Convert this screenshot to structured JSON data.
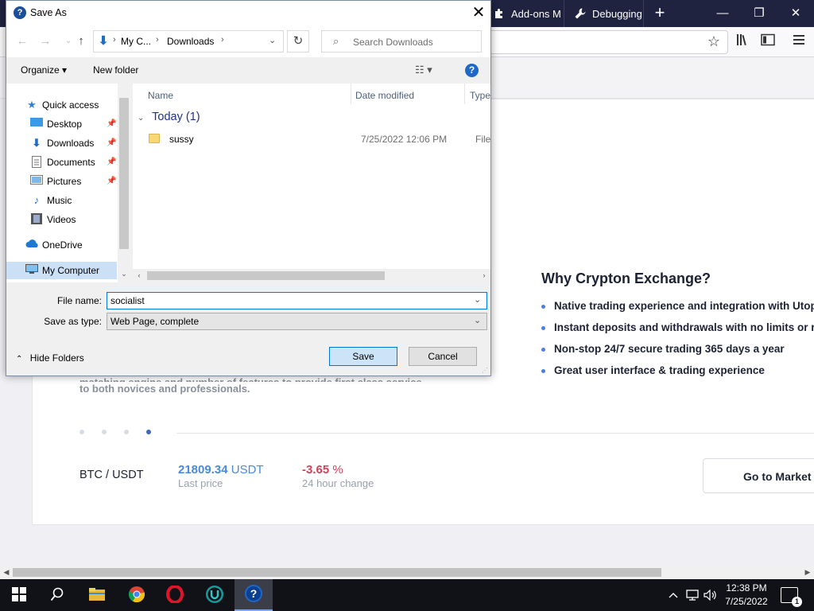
{
  "browser": {
    "tabs": [
      {
        "label": "Add-ons M",
        "icon": "puzzle-icon"
      },
      {
        "label": "Debugging",
        "icon": "wrench-icon"
      }
    ],
    "new_tab": "+",
    "controls": {
      "minimize": "—",
      "maximize": "❐",
      "close": "✕"
    }
  },
  "page": {
    "why_title": "Why Crypton Exchange?",
    "features": [
      "Native trading experience and integration with Utopia",
      "Instant deposits and withdrawals with no limits or restrictions",
      "Non-stop 24/7 secure trading 365 days a year",
      "Great user interface & trading experience"
    ],
    "partial_text_line1": "matching engine and number of features to provide first class service",
    "partial_text_line2": "to both novices and professionals.",
    "pair": "BTC / USDT",
    "last_price_value": "21809.34",
    "last_price_unit": "USDT",
    "last_price_label": "Last price",
    "change_value": "-3.65",
    "change_unit": "%",
    "change_label": "24 hour change",
    "market_button": "Go to Market View",
    "slider_dots": 4,
    "active_dot": 4
  },
  "dialog": {
    "title": "Save As",
    "close": "✕",
    "breadcrumb": [
      "My C...",
      "Downloads"
    ],
    "search_placeholder": "Search Downloads",
    "organize": "Organize ▾",
    "new_folder": "New folder",
    "help": "?",
    "nav_items": [
      {
        "label": "Quick access",
        "icon": "star-icon"
      },
      {
        "label": "Desktop",
        "icon": "desktop-icon",
        "pinned": true
      },
      {
        "label": "Downloads",
        "icon": "download-icon",
        "pinned": true
      },
      {
        "label": "Documents",
        "icon": "document-icon",
        "pinned": true
      },
      {
        "label": "Pictures",
        "icon": "picture-icon",
        "pinned": true
      },
      {
        "label": "Music",
        "icon": "music-icon"
      },
      {
        "label": "Videos",
        "icon": "video-icon"
      },
      {
        "label": "OneDrive",
        "icon": "cloud-icon"
      },
      {
        "label": "My Computer",
        "icon": "computer-icon",
        "selected": true
      }
    ],
    "columns": {
      "name": "Name",
      "date": "Date modified",
      "type": "Type"
    },
    "group": "Today (1)",
    "files": [
      {
        "name": "sussy",
        "date": "7/25/2022 12:06 PM",
        "type": "File folder"
      }
    ],
    "filename_label": "File name:",
    "filename_value": "socialist",
    "savetype_label": "Save as type:",
    "savetype_value": "Web Page, complete",
    "hide_folders": "Hide Folders",
    "save": "Save",
    "cancel": "Cancel"
  },
  "taskbar": {
    "apps": [
      "start-icon",
      "search-icon",
      "file-explorer-icon",
      "chrome-icon",
      "opera-icon",
      "utopia-icon",
      "help-app-icon"
    ],
    "time": "12:38 PM",
    "date": "7/25/2022",
    "notifications": "1"
  },
  "colors": {
    "browser_dark": "#202340",
    "accent_blue": "#0078d7",
    "price_blue": "#4a8ad8",
    "change_red": "#d0415a"
  }
}
